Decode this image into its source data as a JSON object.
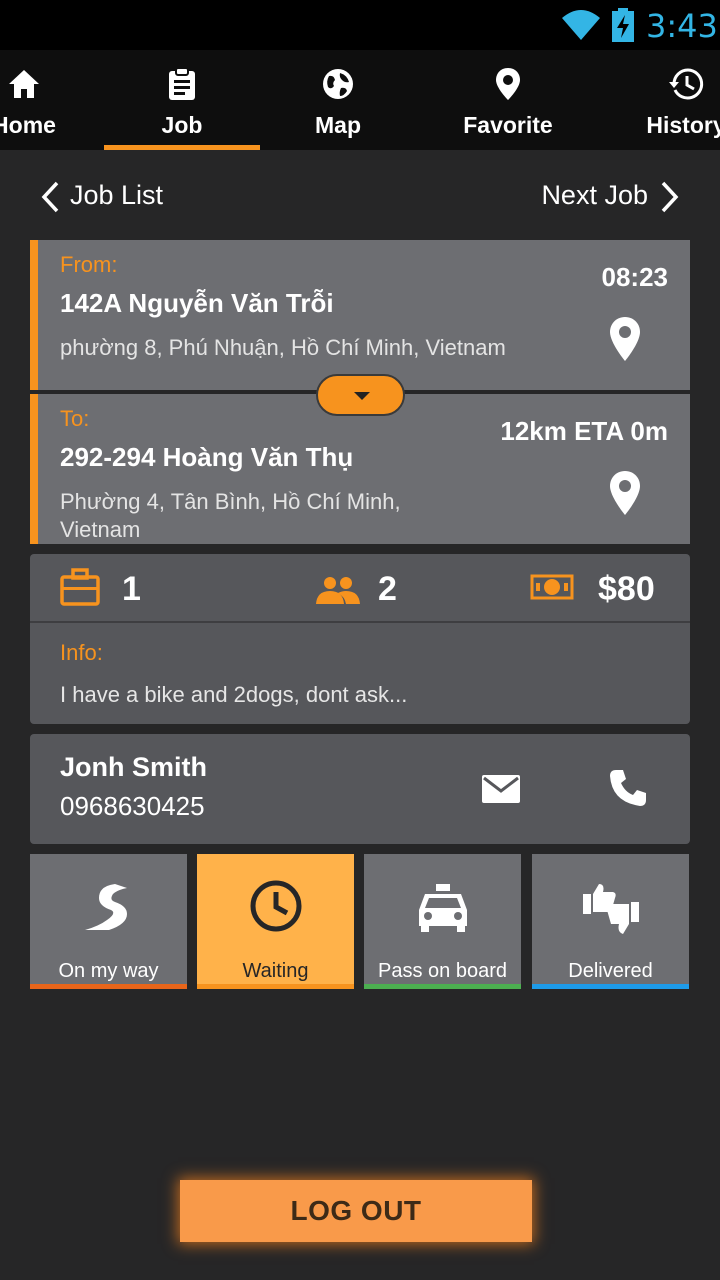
{
  "status_bar": {
    "time": "3:43",
    "time_color": "#33b5e5"
  },
  "tabs": [
    {
      "label": "Home",
      "icon": "home-icon"
    },
    {
      "label": "Job",
      "icon": "clipboard-icon",
      "active": true
    },
    {
      "label": "Map",
      "icon": "globe-icon"
    },
    {
      "label": "Favorite",
      "icon": "location-pin-icon"
    },
    {
      "label": "History",
      "icon": "history-icon"
    }
  ],
  "job_nav": {
    "prev_label": "Job List",
    "next_label": "Next Job"
  },
  "from": {
    "label": "From:",
    "street": "142A Nguyễn Văn Trỗi",
    "rest": "phường 8, Phú Nhuận, Hồ Chí Minh, Vietnam",
    "time": "08:23"
  },
  "to": {
    "label": "To:",
    "street": "292-294 Hoàng Văn Thụ",
    "rest": "Phường 4, Tân Bình, Hồ Chí Minh, Vietnam",
    "eta": "12km ETA 0m"
  },
  "stats": {
    "luggage": "1",
    "passengers": "2",
    "price": "$80"
  },
  "info": {
    "label": "Info:",
    "text": "I have a bike and 2dogs, dont ask..."
  },
  "contact": {
    "name": "Jonh Smith",
    "phone": "0968630425"
  },
  "status_buttons": [
    {
      "label": "On my way",
      "icon": "road-icon",
      "bar_color": "#e8651a"
    },
    {
      "label": "Waiting",
      "icon": "clock-icon",
      "bar_color": "#f7931e",
      "active": true
    },
    {
      "label": "Pass on board",
      "icon": "taxi-icon",
      "bar_color": "#4caf50"
    },
    {
      "label": "Delivered",
      "icon": "thumbs-icon",
      "bar_color": "#1e9be9"
    }
  ],
  "logout_label": "LOG OUT",
  "colors": {
    "accent": "#f7931e",
    "card": "#6d6e72",
    "background": "#262627"
  }
}
